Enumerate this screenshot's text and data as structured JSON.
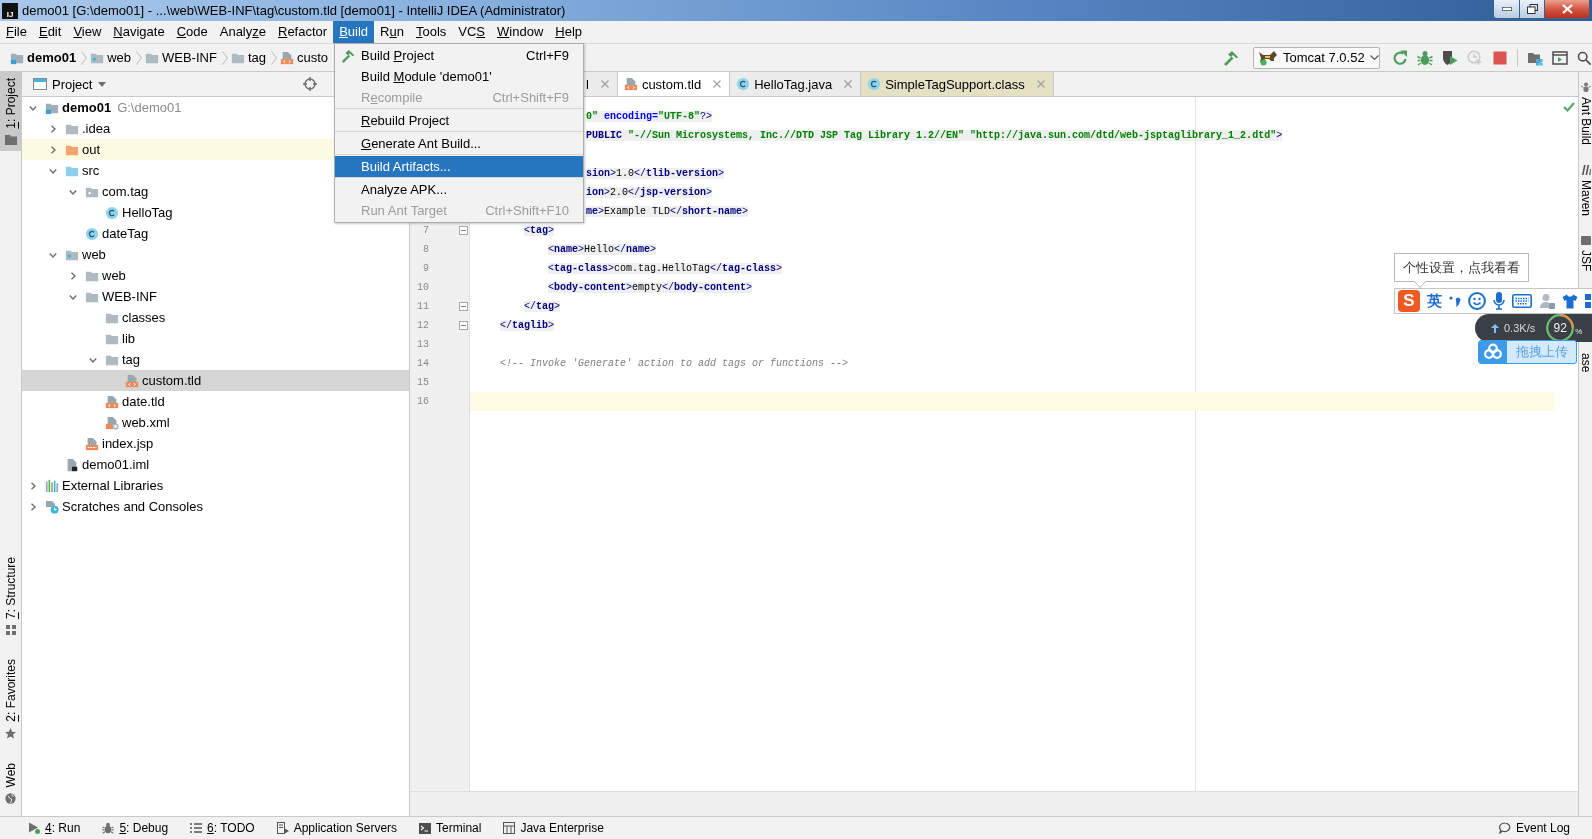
{
  "window": {
    "logo_text": "IJ",
    "title": "demo01 [G:\\demo01] - ...\\web\\WEB-INF\\tag\\custom.tld [demo01] - IntelliJ IDEA (Administrator)"
  },
  "menu_bar": [
    {
      "key": "F",
      "after": "ile",
      "selected": false
    },
    {
      "key": "E",
      "after": "dit",
      "selected": false
    },
    {
      "key": "V",
      "after": "iew",
      "selected": false
    },
    {
      "key": "N",
      "after": "avigate",
      "selected": false
    },
    {
      "key": "C",
      "after": "ode",
      "selected": false
    },
    {
      "before": "Analy",
      "key": "z",
      "after": "e",
      "selected": false
    },
    {
      "key": "R",
      "after": "efactor",
      "selected": false
    },
    {
      "key": "B",
      "after": "uild",
      "selected": true
    },
    {
      "before": "R",
      "key": "u",
      "after": "n",
      "selected": false
    },
    {
      "key": "T",
      "after": "ools",
      "selected": false
    },
    {
      "before": "VC",
      "key": "S",
      "selected": false
    },
    {
      "key": "W",
      "after": "indow",
      "selected": false
    },
    {
      "key": "H",
      "after": "elp",
      "selected": false
    }
  ],
  "build_menu": [
    {
      "kind": "tool",
      "before": "Build ",
      "key": "P",
      "after": "roject",
      "shortcut": "Ctrl+F9",
      "disabled": false,
      "selected": false
    },
    {
      "kind": "command",
      "before": "Build ",
      "key": "M",
      "after": "odule 'demo01'",
      "disabled": false,
      "selected": false
    },
    {
      "kind": "command",
      "before": "R",
      "key": "e",
      "after": "compile",
      "shortcut": "Ctrl+Shift+F9",
      "disabled": true,
      "selected": false
    },
    {
      "kind": "separator"
    },
    {
      "kind": "command",
      "key": "R",
      "after": "ebuild Project",
      "disabled": false,
      "selected": false
    },
    {
      "kind": "separator"
    },
    {
      "kind": "command",
      "key": "G",
      "after": "enerate Ant Build...",
      "disabled": false,
      "selected": false
    },
    {
      "kind": "separator"
    },
    {
      "kind": "command",
      "before": "Build Artifacts...",
      "disabled": false,
      "selected": true
    },
    {
      "kind": "separator"
    },
    {
      "kind": "command",
      "before": "Analyze APK...",
      "disabled": false,
      "selected": false
    },
    {
      "kind": "command",
      "before": "Run Ant Target",
      "shortcut": "Ctrl+Shift+F10",
      "disabled": true,
      "selected": false
    }
  ],
  "nav_bar": {
    "breadcrumbs": [
      {
        "kind": "module",
        "label": "demo01"
      },
      {
        "kind": "web-folder",
        "label": "web"
      },
      {
        "kind": "folder",
        "label": "WEB-INF"
      },
      {
        "kind": "folder",
        "label": "tag"
      },
      {
        "kind": "tld",
        "label": "custo"
      }
    ],
    "run_config": "Tomcat 7.0.52",
    "buttons": [
      {
        "disabled": false
      },
      {
        "disabled": false
      },
      {
        "disabled": false
      },
      {
        "disabled": true
      },
      {
        "disabled": false
      }
    ]
  },
  "tool_strip_left": [
    {
      "kind": "project",
      "key": "1",
      "after": ": Project",
      "selected": true
    },
    {
      "kind": "structure",
      "key": "7",
      "after": ": Structure",
      "selected": false
    },
    {
      "kind": "favorites",
      "key": "2",
      "after": ": Favorites",
      "selected": false
    },
    {
      "kind": "web",
      "before": "Web",
      "selected": false
    }
  ],
  "project_panel": {
    "title": "Project",
    "tree": [
      {
        "kind": "module",
        "label": "demo01",
        "path": "G:\\demo01",
        "expanded": true,
        "selected": false,
        "highlighted": false,
        "children": [
          {
            "kind": "folder",
            "label": ".idea",
            "expanded": false,
            "selected": false,
            "highlighted": false
          },
          {
            "kind": "excluded-folder",
            "label": "out",
            "expanded": false,
            "selected": false,
            "highlighted": true
          },
          {
            "kind": "source-folder",
            "label": "src",
            "expanded": true,
            "selected": false,
            "highlighted": false,
            "children": [
              {
                "kind": "package",
                "label": "com.tag",
                "expanded": true,
                "selected": false,
                "highlighted": false,
                "children": [
                  {
                    "kind": "class",
                    "label": "HelloTag",
                    "selected": false,
                    "highlighted": false
                  }
                ]
              },
              {
                "kind": "class",
                "label": "dateTag",
                "selected": false,
                "highlighted": false
              }
            ]
          },
          {
            "kind": "web-folder",
            "label": "web",
            "expanded": true,
            "selected": false,
            "highlighted": false,
            "children": [
              {
                "kind": "folder",
                "label": "web",
                "expanded": false,
                "selected": false,
                "highlighted": false
              },
              {
                "kind": "folder",
                "label": "WEB-INF",
                "expanded": true,
                "selected": false,
                "highlighted": false,
                "children": [
                  {
                    "kind": "folder",
                    "label": "classes",
                    "selected": false,
                    "highlighted": false
                  },
                  {
                    "kind": "folder",
                    "label": "lib",
                    "selected": false,
                    "highlighted": false
                  },
                  {
                    "kind": "folder",
                    "label": "tag",
                    "expanded": true,
                    "selected": false,
                    "highlighted": false,
                    "children": [
                      {
                        "kind": "tld",
                        "label": "custom.tld",
                        "selected": true,
                        "highlighted": false
                      }
                    ]
                  },
                  {
                    "kind": "tld",
                    "label": "date.tld",
                    "selected": false,
                    "highlighted": false
                  },
                  {
                    "kind": "xml",
                    "label": "web.xml",
                    "selected": false,
                    "highlighted": false
                  }
                ]
              },
              {
                "kind": "jsp",
                "label": "index.jsp",
                "selected": false,
                "highlighted": false
              }
            ]
          },
          {
            "kind": "iml",
            "label": "demo01.iml",
            "selected": false,
            "highlighted": false
          }
        ]
      },
      {
        "kind": "libraries",
        "label": "External Libraries",
        "expanded": false,
        "selected": false,
        "highlighted": false
      },
      {
        "kind": "scratches",
        "label": "Scratches and Consoles",
        "expanded": false,
        "selected": false,
        "highlighted": false
      }
    ]
  },
  "editor": {
    "tabs": [
      {
        "label": "l",
        "selected": false
      },
      {
        "kind": "tld",
        "label": "custom.tld",
        "selected": true
      },
      {
        "kind": "class",
        "label": "HelloTag.java",
        "selected": false
      },
      {
        "kind": "class",
        "label": "SimpleTagSupport.class",
        "selected": false,
        "color": "#e3e0c4"
      }
    ],
    "lines": [
      {
        "kind": "clipped",
        "tokens": [
          {
            "kind": "value",
            "text": "0\""
          },
          {
            "kind": "attr",
            "text": " encoding="
          },
          {
            "kind": "value",
            "text": "\"UTF-8\""
          },
          {
            "kind": "punct",
            "text": "?>"
          }
        ],
        "folding": false,
        "current": false
      },
      {
        "kind": "clipped",
        "tokens": [
          {
            "kind": "tag",
            "text": "PUBLIC"
          },
          {
            "kind": "value",
            "text": " \"-//Sun Microsystems, Inc.//DTD JSP Tag Library 1.2//EN\""
          },
          {
            "kind": "value",
            "text": " \"http://java.sun.com/dtd/web-jsptaglibrary_1_2.dtd\""
          },
          {
            "kind": "punct",
            "text": ">"
          }
        ],
        "folding": false,
        "current": false
      },
      {
        "kind": "code",
        "folding": false,
        "current": false,
        "children": [
          {
            "kind": "clipped",
            "tokens": [
              {
                "kind": "tag",
                "text": "sion"
              },
              {
                "kind": "punct",
                "text": ">"
              },
              {
                "kind": "text",
                "text": "1.0"
              },
              {
                "kind": "punct",
                "text": "</"
              },
              {
                "kind": "tag",
                "text": "tlib-version"
              },
              {
                "kind": "punct",
                "text": ">"
              }
            ],
            "folding": false,
            "current": false
          },
          {
            "kind": "clipped",
            "tokens": [
              {
                "kind": "tag",
                "text": "ion"
              },
              {
                "kind": "punct",
                "text": ">"
              },
              {
                "kind": "text",
                "text": "2.0"
              },
              {
                "kind": "punct",
                "text": "</"
              },
              {
                "kind": "tag",
                "text": "jsp-version"
              },
              {
                "kind": "punct",
                "text": ">"
              }
            ],
            "folding": false,
            "current": false
          },
          {
            "kind": "clipped",
            "tokens": [
              {
                "kind": "tag",
                "text": "me"
              },
              {
                "kind": "punct",
                "text": ">"
              },
              {
                "kind": "text",
                "text": "Example TLD"
              },
              {
                "kind": "punct",
                "text": "</"
              },
              {
                "kind": "tag",
                "text": "short-name"
              },
              {
                "kind": "punct",
                "text": ">"
              }
            ],
            "folding": false,
            "current": false
          },
          {
            "kind": "code",
            "number": "7",
            "tokens": [
              {
                "kind": "punct",
                "text": "<"
              },
              {
                "kind": "tag",
                "text": "tag"
              },
              {
                "kind": "punct",
                "text": ">"
              }
            ],
            "folding": true,
            "current": false,
            "children": [
              {
                "kind": "code",
                "number": "8",
                "tokens": [
                  {
                    "kind": "punct",
                    "text": "<"
                  },
                  {
                    "kind": "tag",
                    "text": "name"
                  },
                  {
                    "kind": "punct",
                    "text": ">"
                  },
                  {
                    "kind": "text",
                    "text": "Hello"
                  },
                  {
                    "kind": "punct",
                    "text": "</"
                  },
                  {
                    "kind": "tag",
                    "text": "name"
                  },
                  {
                    "kind": "punct",
                    "text": ">"
                  }
                ],
                "folding": false,
                "current": false
              },
              {
                "kind": "code",
                "number": "9",
                "tokens": [
                  {
                    "kind": "punct",
                    "text": "<"
                  },
                  {
                    "kind": "tag",
                    "text": "tag-class"
                  },
                  {
                    "kind": "punct",
                    "text": ">"
                  },
                  {
                    "kind": "text",
                    "text": "com.tag.HelloTag"
                  },
                  {
                    "kind": "punct",
                    "text": "</"
                  },
                  {
                    "kind": "tag",
                    "text": "tag-class"
                  },
                  {
                    "kind": "punct",
                    "text": ">"
                  }
                ],
                "folding": false,
                "current": false
              },
              {
                "kind": "code",
                "number": "10",
                "tokens": [
                  {
                    "kind": "punct",
                    "text": "<"
                  },
                  {
                    "kind": "tag",
                    "text": "body-content"
                  },
                  {
                    "kind": "punct",
                    "text": ">"
                  },
                  {
                    "kind": "text",
                    "text": "empty"
                  },
                  {
                    "kind": "punct",
                    "text": "</"
                  },
                  {
                    "kind": "tag",
                    "text": "body-content"
                  },
                  {
                    "kind": "punct",
                    "text": ">"
                  }
                ],
                "folding": false,
                "current": false
              }
            ]
          },
          {
            "kind": "code",
            "number": "11",
            "tokens": [
              {
                "kind": "punct",
                "text": "</"
              },
              {
                "kind": "tag",
                "text": "tag"
              },
              {
                "kind": "punct",
                "text": ">"
              }
            ],
            "folding": true,
            "current": false
          }
        ]
      },
      {
        "kind": "code",
        "number": "12",
        "tokens": [
          {
            "kind": "punct",
            "text": "</"
          },
          {
            "kind": "tag",
            "text": "taglib"
          },
          {
            "kind": "punct",
            "text": ">"
          }
        ],
        "folding": true,
        "current": false
      },
      {
        "kind": "code",
        "number": "13",
        "folding": false,
        "current": false
      },
      {
        "kind": "code",
        "number": "14",
        "tokens": [
          {
            "kind": "comment",
            "text": "<!-- Invoke 'Generate' action to add tags or functions -->"
          }
        ],
        "folding": false,
        "current": false
      },
      {
        "kind": "code",
        "number": "15",
        "folding": false,
        "current": false
      },
      {
        "kind": "code",
        "number": "16",
        "folding": false,
        "current": true
      }
    ]
  },
  "right_strip": [
    {
      "kind": "ant",
      "label": "Ant Build"
    },
    {
      "kind": "maven",
      "label": "Maven"
    },
    {
      "kind": "jsf",
      "label": "JSF"
    },
    {
      "label": "ase"
    }
  ],
  "bottom_bar": {
    "tools": [
      {
        "kind": "run",
        "key": "4",
        "after": ": Run"
      },
      {
        "kind": "debug",
        "key": "5",
        "after": ": Debug"
      },
      {
        "kind": "todo",
        "key": "6",
        "after": ": TODO"
      },
      {
        "kind": "servers",
        "before": "Application Servers"
      },
      {
        "kind": "terminal",
        "before": "Terminal"
      },
      {
        "kind": "enterprise",
        "before": "Java Enterprise"
      }
    ],
    "event_log": "Event Log"
  },
  "ime": {
    "tooltip": "个性设置，点我看看",
    "logo_text": "S",
    "mode": "英"
  },
  "speed_widget": {
    "speed": "0.3K/s",
    "percent": "92",
    "percent_sign": "%"
  },
  "upload_button": {
    "label": "拖拽上传"
  }
}
